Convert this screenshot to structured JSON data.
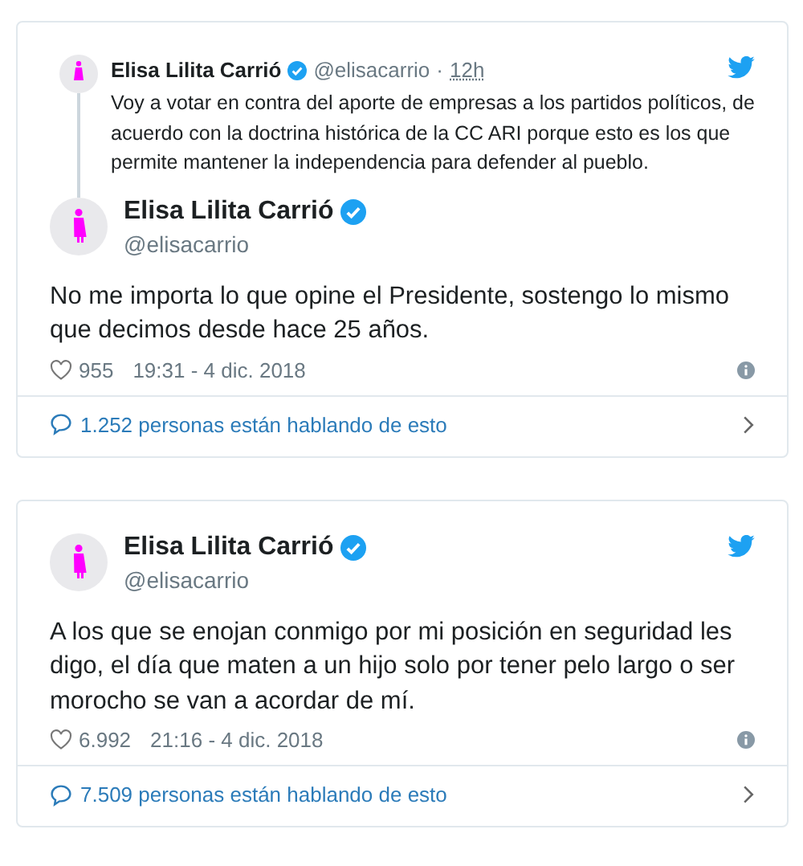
{
  "tweets": [
    {
      "quoted": {
        "name": "Elisa Lilita Carrió",
        "verified": true,
        "handle": "@elisacarrio",
        "separator": "·",
        "time": "12h",
        "text": "Voy a votar en contra del aporte de empresas a los partidos políticos, de acuerdo con la doctrina histórica de la CC ARI porque esto es los que permite mantener la independencia para defender al pueblo."
      },
      "name": "Elisa Lilita Carrió",
      "verified": true,
      "handle": "@elisacarrio",
      "text": "No me importa lo que opine el Presidente, sostengo lo mismo que decimos desde hace 25 años.",
      "likes": "955",
      "timestamp": "19:31 - 4 dic. 2018",
      "conversation": "1.252 personas están hablando de esto"
    },
    {
      "name": "Elisa Lilita Carrió",
      "verified": true,
      "handle": "@elisacarrio",
      "text": "A los que se enojan conmigo por mi posición en seguridad les digo, el día que maten a un hijo solo por tener pelo largo o ser morocho se van a acordar de mí.",
      "likes": "6.992",
      "timestamp": "21:16 - 4 dic. 2018",
      "conversation": "7.509 personas están hablando de esto"
    }
  ]
}
